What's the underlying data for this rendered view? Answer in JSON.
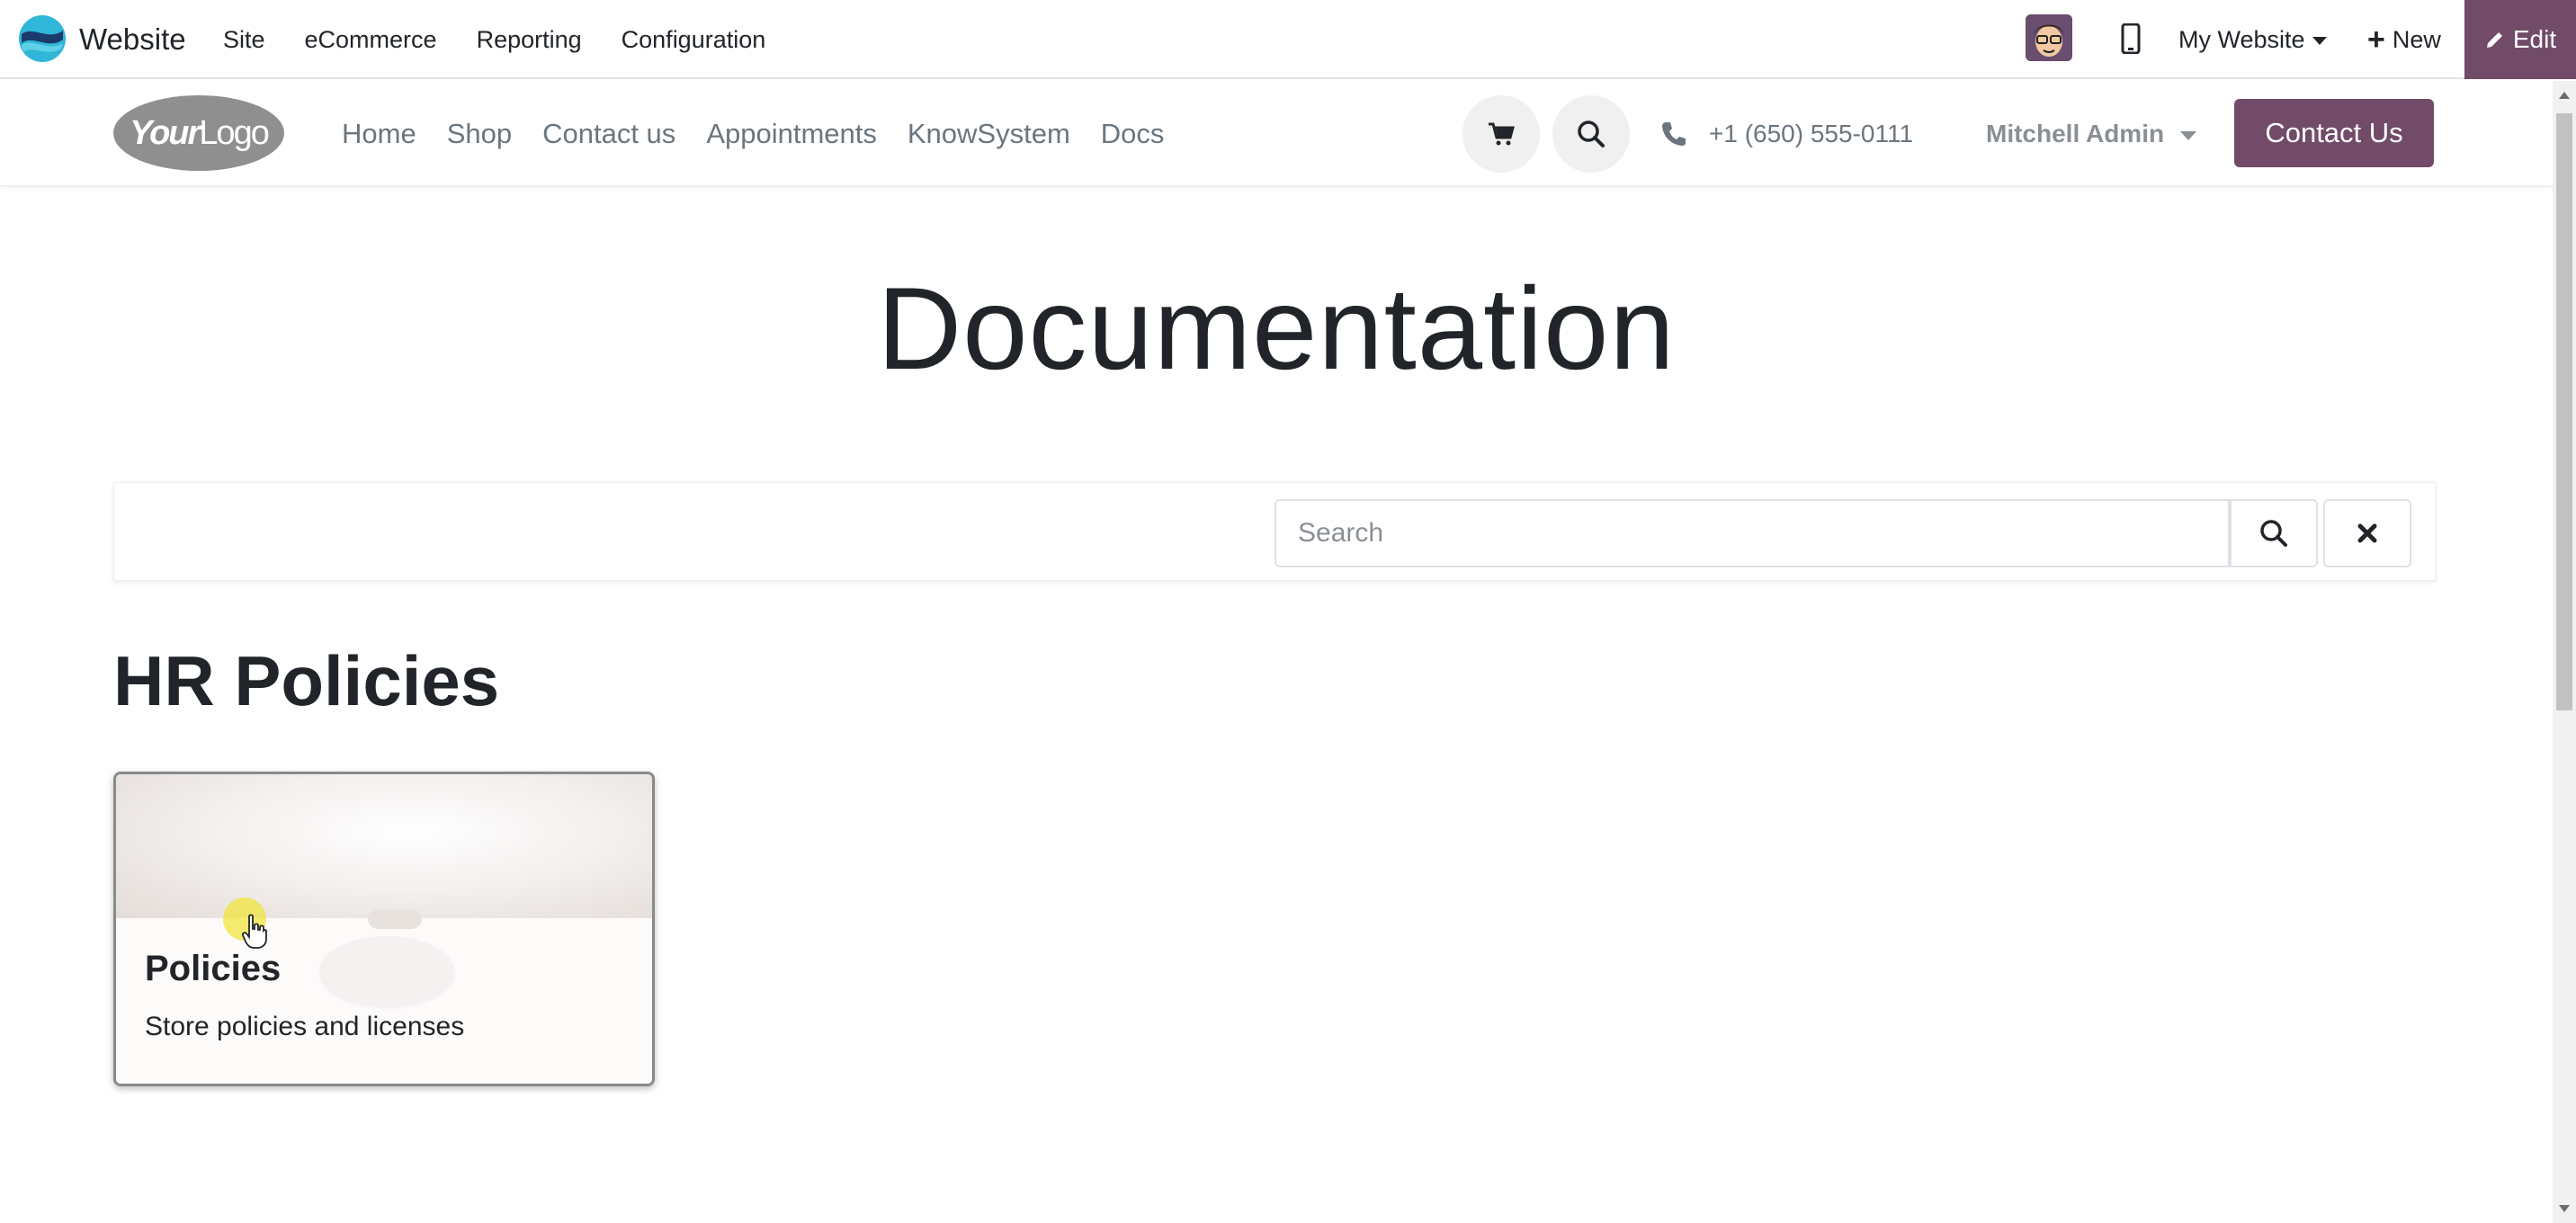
{
  "adminbar": {
    "app_name": "Website",
    "menu": [
      "Site",
      "eCommerce",
      "Reporting",
      "Configuration"
    ],
    "website_selector": "My Website",
    "new_label": "New",
    "edit_label": "Edit"
  },
  "header": {
    "logo_text_bold": "Your",
    "logo_text": "Logo",
    "nav": [
      "Home",
      "Shop",
      "Contact us",
      "Appointments",
      "KnowSystem",
      "Docs"
    ],
    "phone": "+1 (650) 555-0111",
    "user": "Mitchell Admin",
    "cta": "Contact Us"
  },
  "page": {
    "title": "Documentation",
    "search_placeholder": "Search",
    "section_title": "HR Policies",
    "card": {
      "title": "Policies",
      "description": "Store policies and licenses"
    }
  },
  "colors": {
    "brand": "#714b67",
    "text": "#212529",
    "muted": "#6c757d"
  }
}
